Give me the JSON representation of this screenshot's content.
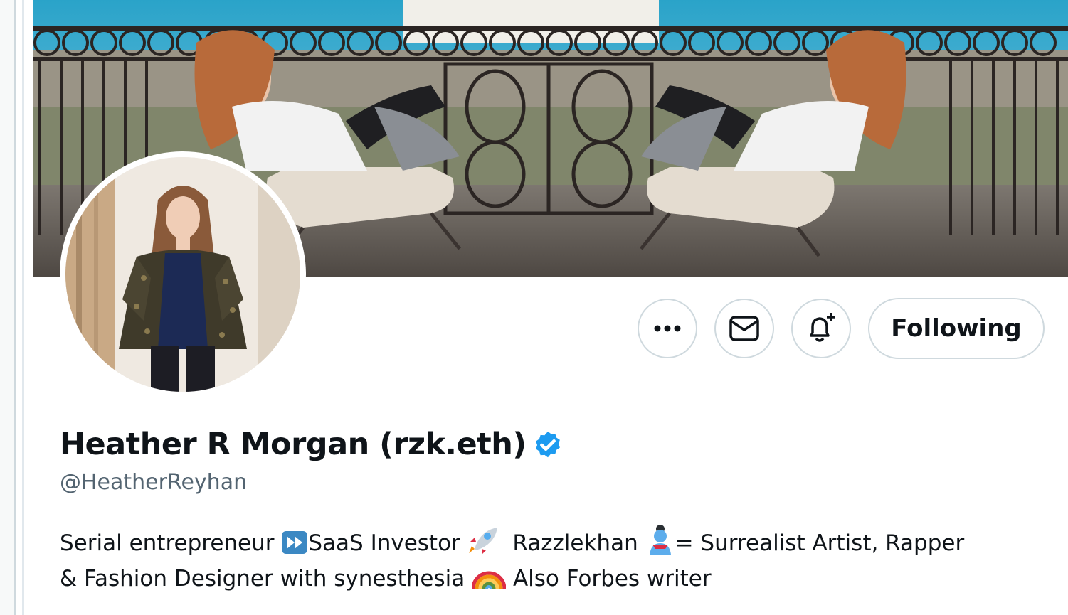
{
  "profile": {
    "display_name": "Heather R Morgan (rzk.eth)",
    "handle": "@HeatherReyhan",
    "verified": true,
    "bio": {
      "line1_part1": "Serial entrepreneur",
      "line1_part2": "SaaS Investor",
      "line1_part3": "Razzlekhan",
      "line1_part4": "= Surrealist Artist, Rapper",
      "line2_part1": "& Fashion Designer with synesthesia",
      "line2_part2": "Also Forbes writer",
      "emojis": [
        "fast-forward-emoji",
        "rocket-emoji",
        "genie-emoji",
        "rainbow-emoji"
      ]
    }
  },
  "actions": {
    "more_icon": "more-horizontal-icon",
    "message_icon": "mail-icon",
    "notify_icon": "bell-plus-icon",
    "follow_label": "Following"
  },
  "colors": {
    "text_primary": "#0f1419",
    "text_secondary": "#536471",
    "verified_blue": "#1d9bf0",
    "border": "#cfd9de"
  }
}
